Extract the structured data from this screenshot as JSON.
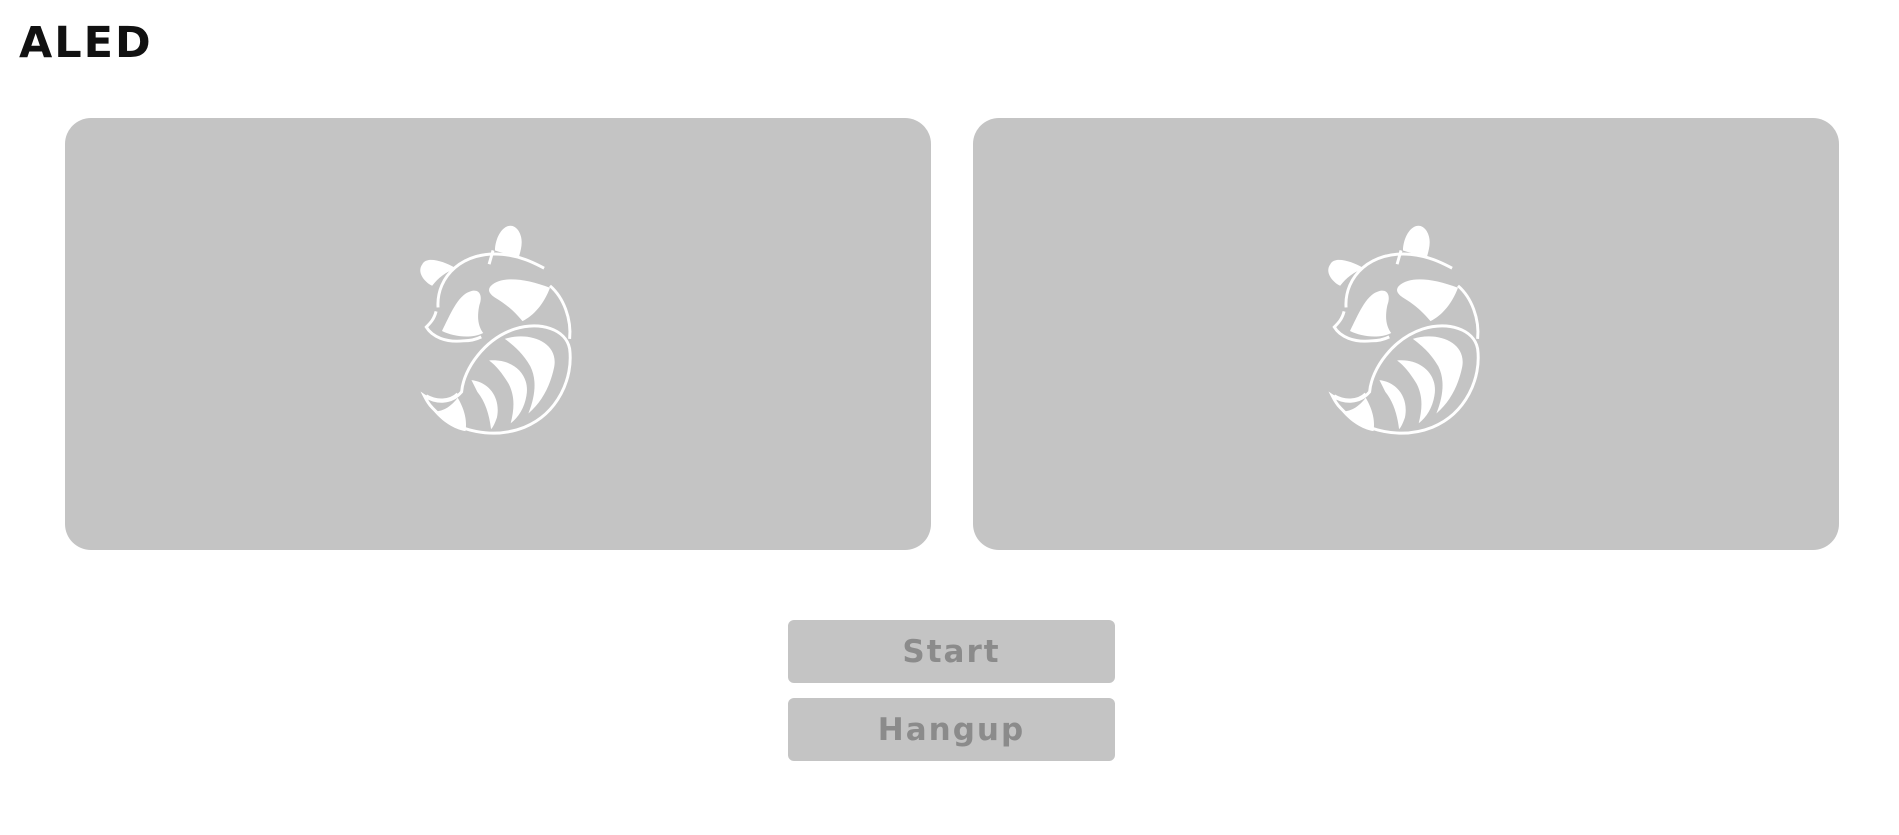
{
  "app": {
    "title": "ALED"
  },
  "videos": {
    "local": {
      "placeholder_icon": "raccoon-icon"
    },
    "remote": {
      "placeholder_icon": "raccoon-icon"
    }
  },
  "controls": {
    "start_label": "Start",
    "hangup_label": "Hangup"
  },
  "colors": {
    "panel_background": "#c4c4c4",
    "icon_color": "#ffffff",
    "button_text": "#8b8b8b",
    "title_text": "#111111"
  }
}
